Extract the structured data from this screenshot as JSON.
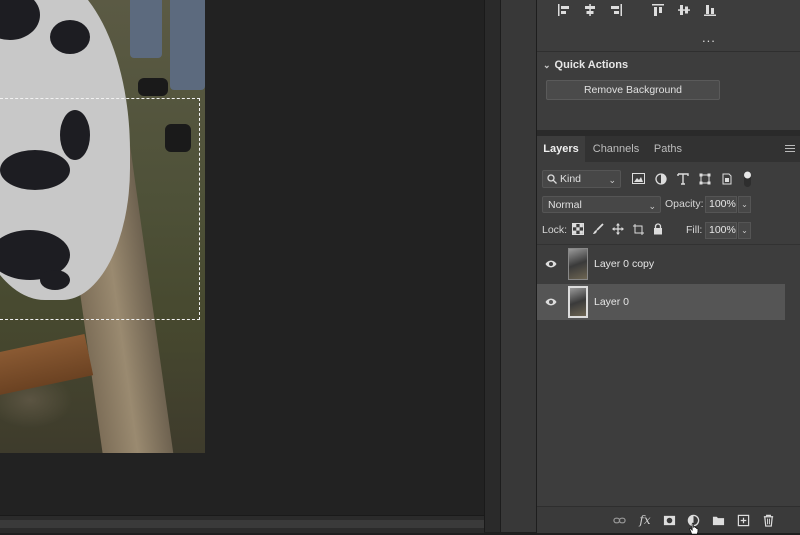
{
  "quick_actions": {
    "title": "Quick Actions",
    "remove_background": "Remove Background"
  },
  "more": "...",
  "tabs": [
    "Layers",
    "Channels",
    "Paths"
  ],
  "filter": {
    "kind": "Kind"
  },
  "blend": {
    "mode": "Normal",
    "opacity_label": "Opacity:",
    "opacity": "100%"
  },
  "lock": {
    "label": "Lock:",
    "fill_label": "Fill:",
    "fill": "100%"
  },
  "layers": [
    {
      "name": "Layer 0 copy",
      "visible": true,
      "selected": false
    },
    {
      "name": "Layer 0",
      "visible": true,
      "selected": true
    }
  ],
  "bottom_bar": {
    "fx": "fx"
  },
  "colors": {
    "panel_bg": "#3d3d3d",
    "canvas_bg": "#222222",
    "selected_row": "#555555"
  }
}
